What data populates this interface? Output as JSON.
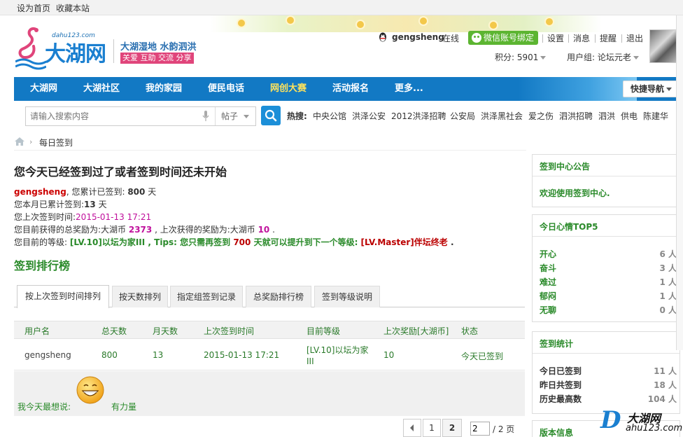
{
  "topbar": {
    "set_home": "设为首页",
    "bookmark": "收藏本站"
  },
  "header": {
    "logo_url": "dahu123.com",
    "logo_text": "大湖网",
    "slogan1": "大湖湿地 水韵泗洪",
    "slogan2": "关爱 互助 交流 分享",
    "username": "gengsheng",
    "online": "在线",
    "wechat_bind": "微信账号绑定",
    "links": [
      "设置",
      "消息",
      "提醒",
      "退出"
    ],
    "points": "积分: 5901",
    "usergroup": "用户组: 论坛元老"
  },
  "nav": {
    "items": [
      "大湖网",
      "大湖社区",
      "我的家园",
      "便民电话",
      "网创大赛",
      "活动报名",
      "更多..."
    ],
    "quick_nav": "快捷导航"
  },
  "search": {
    "placeholder": "请输入搜索内容",
    "type": "帖子",
    "hot_label": "热搜:",
    "hot_terms": [
      "中央公馆",
      "洪泽公安",
      "2012洪泽招聘",
      "公安局",
      "洪泽黑社会",
      "爱之伤",
      "泗洪招聘",
      "泗洪",
      "供电",
      "陈建华"
    ]
  },
  "breadcrumb": {
    "current": "每日签到"
  },
  "main": {
    "title": "您今天已经签到过了或者签到时间还未开始",
    "username": "gengsheng",
    "total_prefix": ", 您累计已签到: ",
    "total_days": "800",
    "total_suffix": " 天",
    "month_prefix": "您本月已累计签到:",
    "month_days": "13",
    "month_suffix": " 天",
    "last_prefix": "您上次签到时间:",
    "last_time": "2015-01-13 17:21",
    "reward_prefix": "您目前获得的总奖励为:大湖币 ",
    "reward_total": "2373",
    "reward_mid": " , 上次获得的奖励为:大湖币 ",
    "reward_last": "10",
    "reward_end": " .",
    "level_prefix": "您目前的等级: ",
    "level_current": "[LV.10]以坛为家III",
    "level_tips": " , Tips: 您只需再签到 ",
    "level_days": "700",
    "level_mid": " 天就可以提升到下一个等级: ",
    "level_next": "[LV.Master]伴坛终老",
    "level_end": " .",
    "ranking_title": "签到排行榜"
  },
  "tabs": [
    "按上次签到时间排列",
    "按天数排列",
    "指定组签到记录",
    "总奖励排行榜",
    "签到等级说明"
  ],
  "table": {
    "headers": [
      "用户名",
      "总天数",
      "月天数",
      "上次签到时间",
      "目前等级",
      "上次奖励[大湖币]",
      "状态"
    ],
    "rows": [
      {
        "user": "gengsheng",
        "total": "800",
        "month": "13",
        "last": "2015-01-13 17:21",
        "level_line1": "[LV.10]以坛为家",
        "level_line2": "III",
        "reward": "10",
        "status": "今天已签到"
      }
    ],
    "mood_label": "我今天最想说:",
    "mood_text": "有力量"
  },
  "pagination": {
    "pages": [
      "1",
      "2"
    ],
    "current": "2",
    "input_value": "2",
    "total": "/ 2 页"
  },
  "sidebar": {
    "notice_title": "签到中心公告",
    "notice_text": "欢迎使用签到中心.",
    "mood_title": "今日心情TOP5",
    "moods": [
      {
        "name": "开心",
        "count": "6 人"
      },
      {
        "name": "奋斗",
        "count": "3 人"
      },
      {
        "name": "难过",
        "count": "1 人"
      },
      {
        "name": "郁闷",
        "count": "1 人"
      },
      {
        "name": "无聊",
        "count": "0 人"
      }
    ],
    "stats_title": "签到统计",
    "stats": [
      {
        "name": "今日已签到",
        "count": "11 人"
      },
      {
        "name": "昨日共签到",
        "count": "18 人"
      },
      {
        "name": "历史最高数",
        "count": "104 人"
      }
    ],
    "version_title": "版本信息"
  },
  "watermark": {
    "cn": "大湖网",
    "url": "ahu123.com"
  }
}
